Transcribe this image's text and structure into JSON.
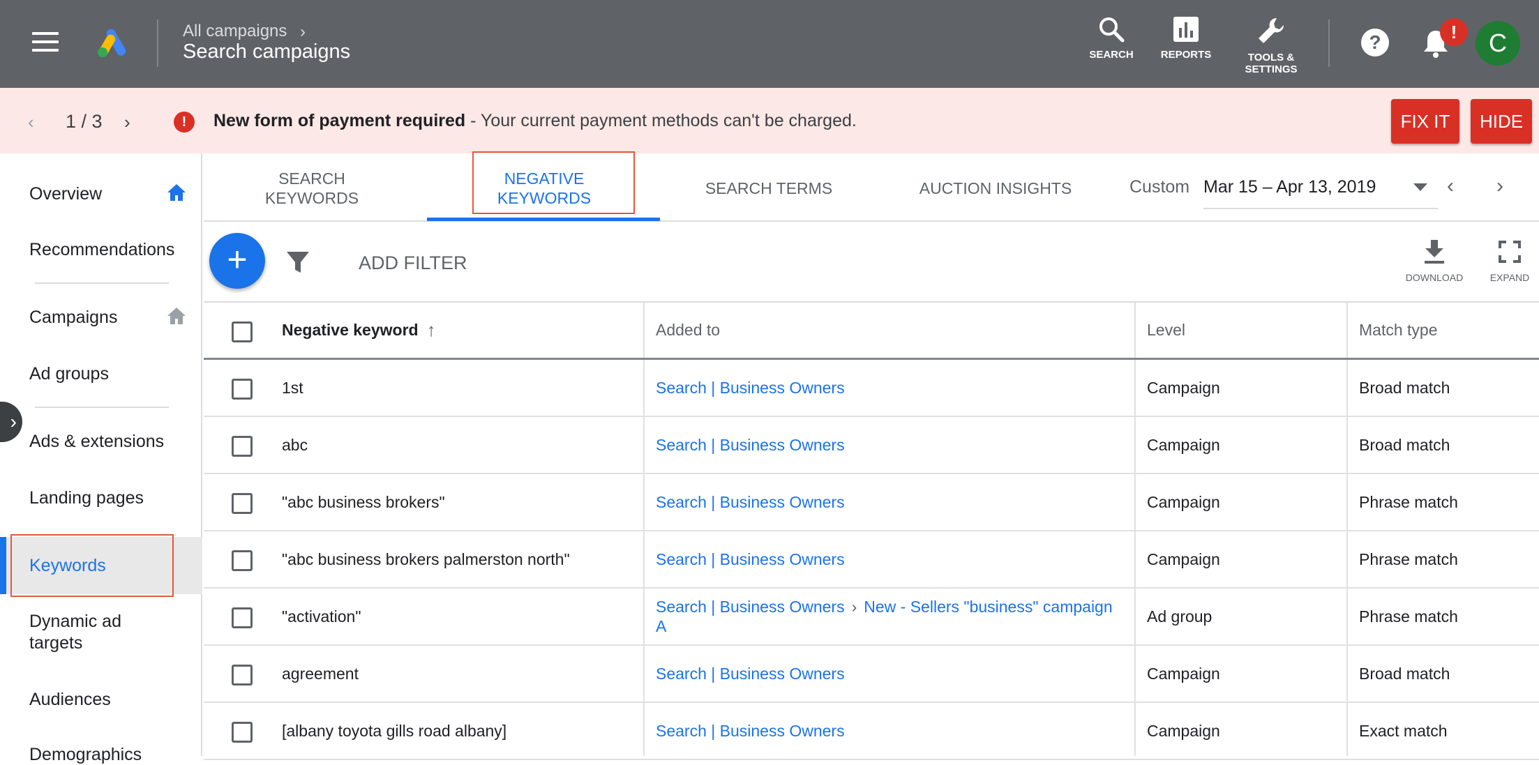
{
  "topbar": {
    "breadcrumb": "All campaigns",
    "title": "Search campaigns",
    "buttons": {
      "search": "SEARCH",
      "reports": "REPORTS",
      "tools_line1": "TOOLS &",
      "tools_line2": "SETTINGS"
    },
    "notification_badge": "!",
    "avatar_letter": "C"
  },
  "alert": {
    "pager": "1 / 3",
    "bold": "New form of payment required",
    "text": " - Your current payment methods can't be charged.",
    "fix_label": "FIX IT",
    "hide_label": "HIDE"
  },
  "sidebar": {
    "items": [
      {
        "label": "Overview"
      },
      {
        "label": "Recommendations"
      },
      {
        "label": "Campaigns"
      },
      {
        "label": "Ad groups"
      },
      {
        "label": "Ads & extensions"
      },
      {
        "label": "Landing pages"
      },
      {
        "label": "Keywords"
      },
      {
        "label": "Dynamic ad"
      },
      {
        "label": "targets"
      },
      {
        "label": "Audiences"
      },
      {
        "label": "Demographics"
      }
    ]
  },
  "tabs": [
    {
      "line1": "SEARCH",
      "line2": "KEYWORDS"
    },
    {
      "line1": "NEGATIVE",
      "line2": "KEYWORDS"
    },
    {
      "line1": "SEARCH TERMS"
    },
    {
      "line1": "AUCTION INSIGHTS"
    }
  ],
  "date": {
    "label": "Custom",
    "range": "Mar 15 – Apr 13, 2019"
  },
  "toolbar": {
    "add_filter": "ADD FILTER",
    "download": "DOWNLOAD",
    "expand": "EXPAND"
  },
  "table": {
    "headers": {
      "keyword": "Negative keyword",
      "added_to": "Added to",
      "level": "Level",
      "match": "Match type"
    },
    "rows": [
      {
        "keyword": "1st",
        "added_to": "Search | Business Owners",
        "level": "Campaign",
        "match": "Broad match"
      },
      {
        "keyword": "abc",
        "added_to": "Search | Business Owners",
        "level": "Campaign",
        "match": "Broad match"
      },
      {
        "keyword": "\"abc business brokers\"",
        "added_to": "Search | Business Owners",
        "level": "Campaign",
        "match": "Phrase match"
      },
      {
        "keyword": "\"abc business brokers palmerston north\"",
        "added_to": "Search | Business Owners",
        "level": "Campaign",
        "match": "Phrase match"
      },
      {
        "keyword": "\"activation\"",
        "added_to": "Search | Business Owners",
        "added_to_sep": "›",
        "added_to_2": "New - Sellers \"business\" campaign",
        "added_to_3": "A",
        "level": "Ad group",
        "match": "Phrase match"
      },
      {
        "keyword": "agreement",
        "added_to": "Search | Business Owners",
        "level": "Campaign",
        "match": "Broad match"
      },
      {
        "keyword": "[albany toyota gills road albany]",
        "added_to": "Search | Business Owners",
        "level": "Campaign",
        "match": "Exact match"
      }
    ]
  },
  "colors": {
    "topbar": "#5f6368",
    "accent": "#1a73e8",
    "alert_bg": "#fce8e6",
    "danger": "#d93025",
    "avatar": "#1e7d32"
  }
}
